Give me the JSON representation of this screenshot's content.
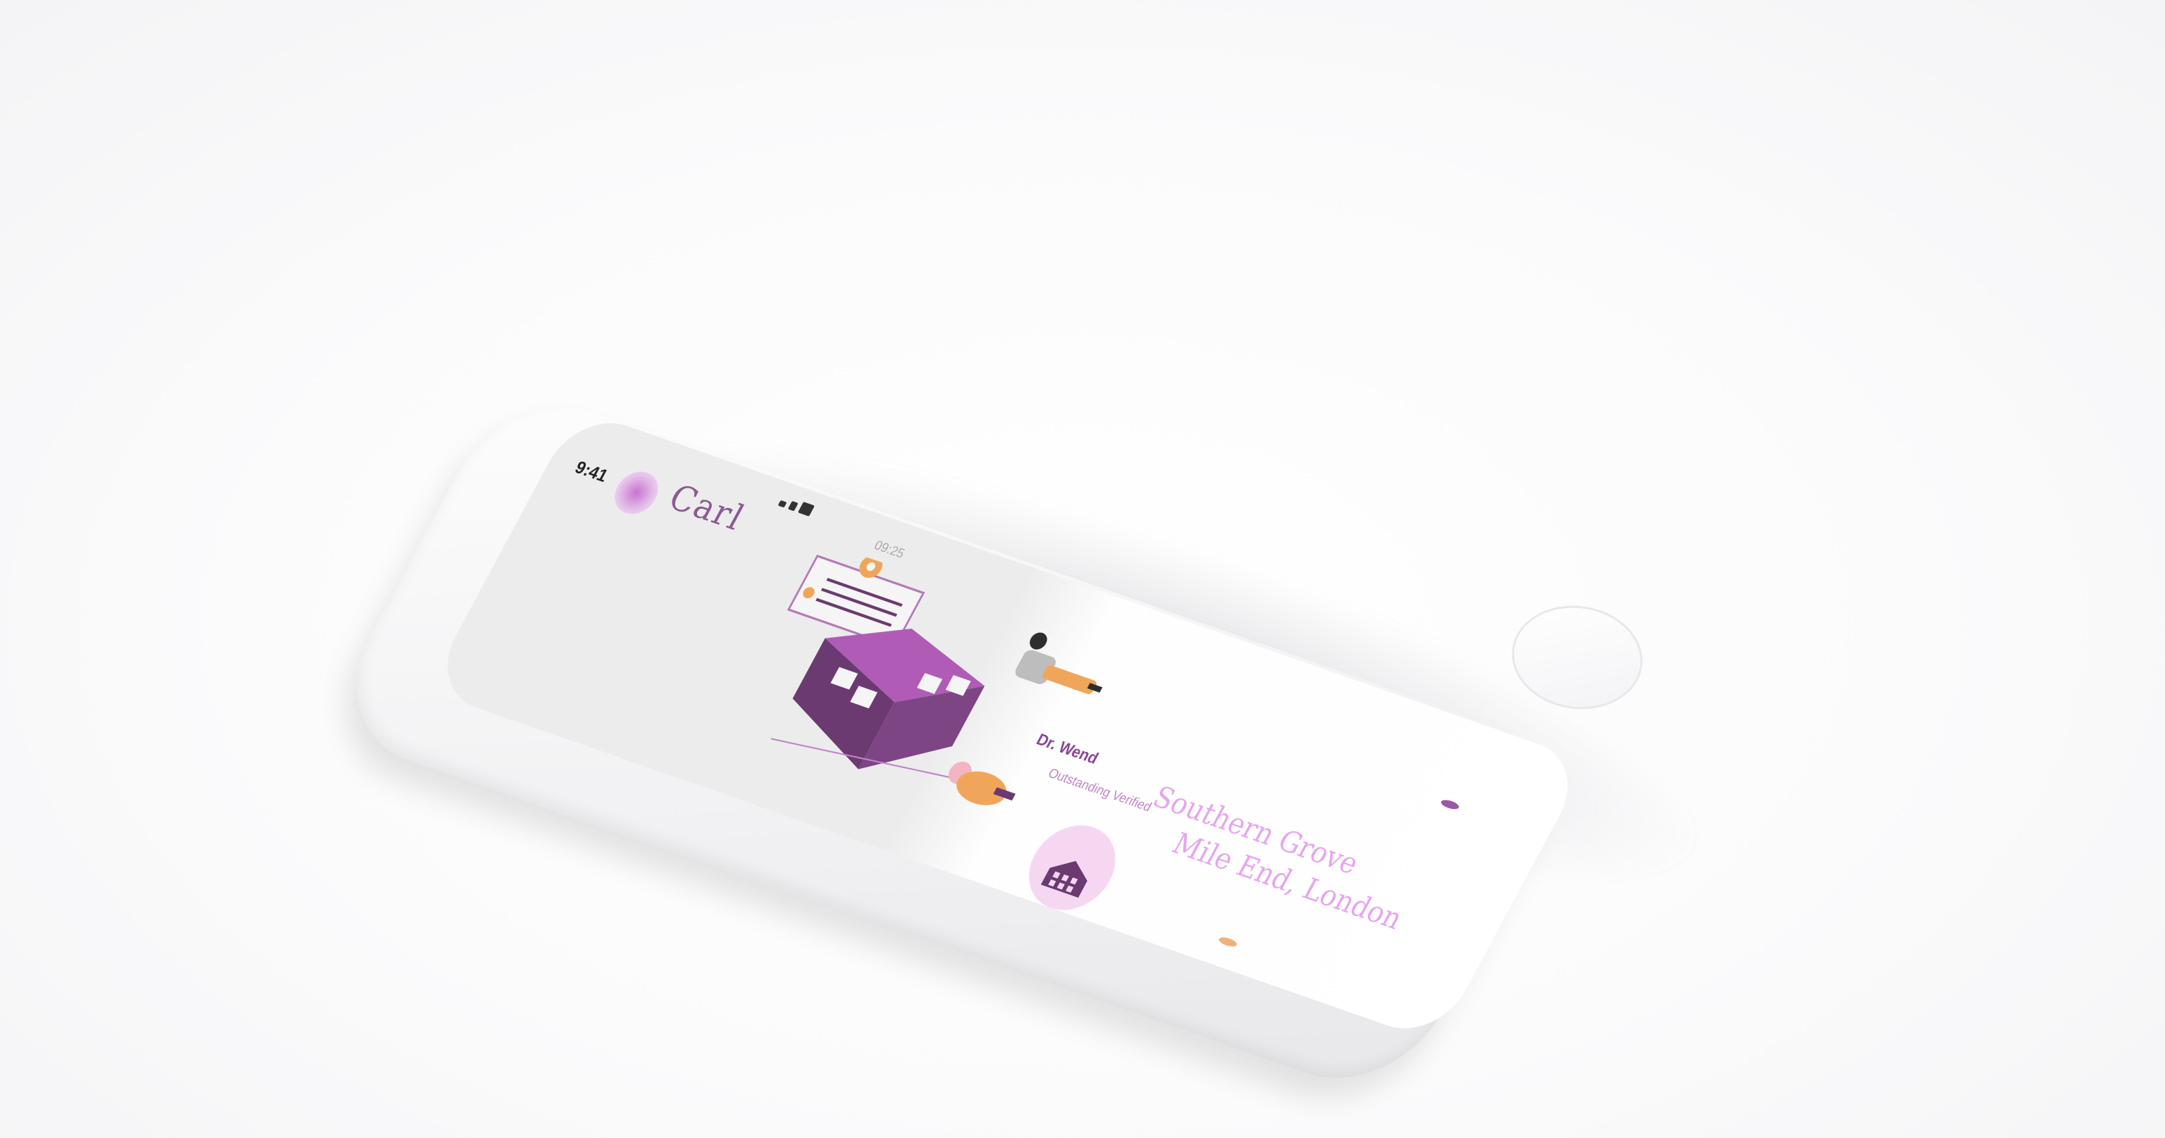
{
  "status_bar": {
    "time": "9:41",
    "right_text": "09:25"
  },
  "header": {
    "name": "Carl"
  },
  "captions": {
    "line_a": "Dr. Wend",
    "line_b": "Outstanding Verified"
  },
  "address": {
    "line1": "Southern Grove",
    "line2": "Mile End, London"
  },
  "colors": {
    "primary": "#8a4696",
    "house_roof": "#b05cb6",
    "house_wall": "#6b3a70",
    "accent_orange": "#f0a65a",
    "text_light": "#e6a6ee"
  },
  "icons": {
    "avatar": "user-avatar-icon",
    "building": "building-icon",
    "pin": "location-pin-icon"
  }
}
